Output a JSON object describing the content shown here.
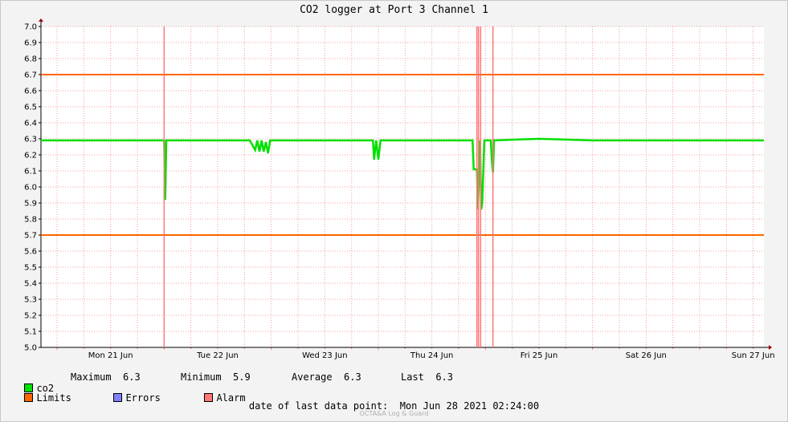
{
  "window": {
    "title": "CO2 logger at Port 3 Channel 1"
  },
  "chart_data": {
    "type": "line",
    "title": "CO2 logger at Port 3 Channel 1",
    "xlabel": "",
    "ylabel": "",
    "ylim": [
      5.0,
      7.0
    ],
    "xlim": [
      -0.15,
      6.6
    ],
    "yticks": [
      "5.0",
      "5.1",
      "5.2",
      "5.3",
      "5.4",
      "5.5",
      "5.6",
      "5.7",
      "5.8",
      "5.9",
      "6.0",
      "6.1",
      "6.2",
      "6.3",
      "6.4",
      "6.5",
      "6.6",
      "6.7",
      "6.8",
      "6.9",
      "7.0"
    ],
    "xticks": [
      {
        "x": 0,
        "label": "Mon 21 Jun"
      },
      {
        "x": 1,
        "label": "Tue 22 Jun"
      },
      {
        "x": 2,
        "label": "Wed 23 Jun"
      },
      {
        "x": 3,
        "label": "Thu 24 Jun"
      },
      {
        "x": 4,
        "label": "Fri 25 Jun"
      },
      {
        "x": 5,
        "label": "Sat 26 Jun"
      },
      {
        "x": 6,
        "label": "Sun 27 Jun"
      }
    ],
    "grid": true,
    "series": [
      {
        "name": "co2",
        "color": "#00e000",
        "points": [
          [
            -0.15,
            6.29
          ],
          [
            0.2,
            6.29
          ],
          [
            0.6,
            6.29
          ],
          [
            0.9,
            6.29
          ],
          [
            1.0,
            6.29
          ],
          [
            1.01,
            5.92
          ],
          [
            1.02,
            6.29
          ],
          [
            1.4,
            6.29
          ],
          [
            1.8,
            6.29
          ],
          [
            1.85,
            6.23
          ],
          [
            1.87,
            6.29
          ],
          [
            1.89,
            6.22
          ],
          [
            1.91,
            6.29
          ],
          [
            1.93,
            6.22
          ],
          [
            1.95,
            6.28
          ],
          [
            1.97,
            6.21
          ],
          [
            1.99,
            6.29
          ],
          [
            2.4,
            6.29
          ],
          [
            2.8,
            6.29
          ],
          [
            2.95,
            6.29
          ],
          [
            2.96,
            6.17
          ],
          [
            2.98,
            6.29
          ],
          [
            3.0,
            6.17
          ],
          [
            3.02,
            6.29
          ],
          [
            3.5,
            6.29
          ],
          [
            3.88,
            6.29
          ],
          [
            3.89,
            6.11
          ],
          [
            3.92,
            6.11
          ],
          [
            3.93,
            5.86
          ],
          [
            3.95,
            6.29
          ],
          [
            3.96,
            5.86
          ],
          [
            3.97,
            5.9
          ],
          [
            3.99,
            6.29
          ],
          [
            4.0,
            6.29
          ],
          [
            4.05,
            6.29
          ],
          [
            4.06,
            6.17
          ],
          [
            4.07,
            6.09
          ],
          [
            4.08,
            6.29
          ],
          [
            4.5,
            6.3
          ],
          [
            5.0,
            6.29
          ],
          [
            5.5,
            6.29
          ],
          [
            6.0,
            6.29
          ],
          [
            6.6,
            6.29
          ]
        ]
      }
    ],
    "limits": {
      "name": "Limits",
      "color": "#ff6600",
      "values": [
        6.7,
        5.7
      ]
    },
    "alarms": {
      "name": "Alarm",
      "color": "#ff7777",
      "x": [
        1.0,
        3.92,
        3.935,
        3.955,
        4.07
      ]
    },
    "errors": {
      "name": "Errors",
      "color": "#8080ff"
    }
  },
  "legend": {
    "co2_label": "co2",
    "max_label": "Maximum",
    "max_value": "6.3",
    "min_label": "Minimum",
    "min_value": "5.9",
    "avg_label": "Average",
    "avg_value": "6.3",
    "last_label": "Last",
    "last_value": "6.3",
    "limits_label": "Limits",
    "errors_label": "Errors",
    "alarm_label": "Alarm",
    "co2_color": "#00e000",
    "limits_color": "#ff6600",
    "errors_color": "#8080ff",
    "alarm_color": "#ff7777"
  },
  "status": {
    "last_point_label": "date of last data point:",
    "last_point_value": "Mon Jun 28 2021 02:24:00"
  },
  "footer": {
    "text": "OCTA&A Log & Guard"
  }
}
